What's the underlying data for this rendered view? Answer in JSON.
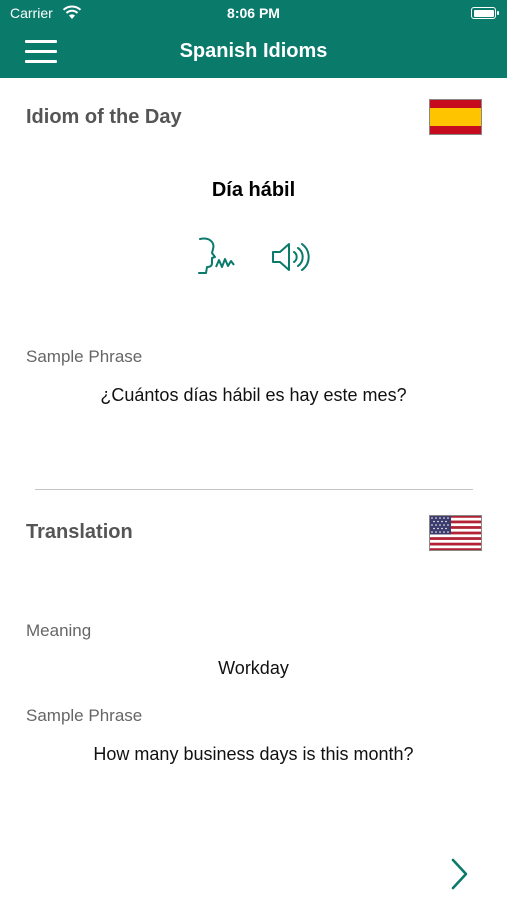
{
  "status_bar": {
    "carrier": "Carrier",
    "time": "8:06 PM"
  },
  "nav": {
    "title": "Spanish Idioms",
    "menu_icon": "hamburger-menu-icon"
  },
  "idiom_section": {
    "title": "Idiom of the Day",
    "flag": "spain-flag-icon",
    "idiom": "Día hábil",
    "pronounce_icon": "speaking-head-icon",
    "audio_icon": "speaker-icon",
    "sample_label": "Sample Phrase",
    "sample_phrase": "¿Cuántos días hábil es hay este mes?"
  },
  "translation_section": {
    "title": "Translation",
    "flag": "us-flag-icon",
    "meaning_label": "Meaning",
    "meaning": "Workday",
    "sample_label": "Sample Phrase",
    "sample_phrase": "How many business days is this month?"
  },
  "next_icon": "chevron-right-icon",
  "colors": {
    "accent": "#0a7a6b",
    "background": "#ffffff"
  }
}
